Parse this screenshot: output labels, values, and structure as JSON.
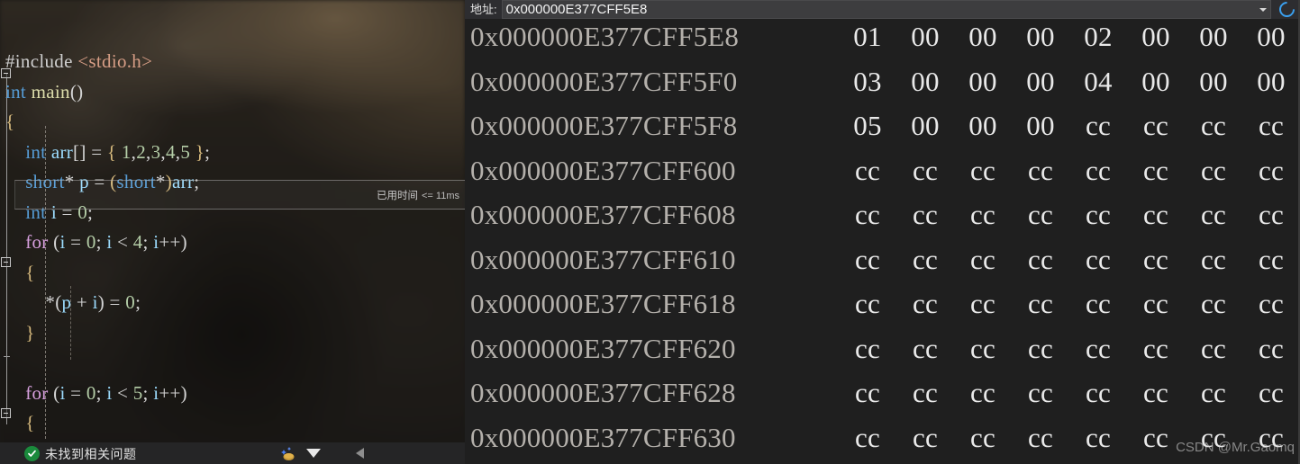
{
  "editor": {
    "code_lines": [
      {
        "indent": 0,
        "tokens": [
          {
            "t": "#include ",
            "c": "pre"
          },
          {
            "t": "<stdio.h>",
            "c": "inc"
          }
        ]
      },
      {
        "indent": 0,
        "tokens": [
          {
            "t": "int ",
            "c": "kw"
          },
          {
            "t": "main",
            "c": "fn"
          },
          {
            "t": "()",
            "c": "punct"
          }
        ]
      },
      {
        "indent": 0,
        "tokens": [
          {
            "t": "{",
            "c": "brace"
          }
        ]
      },
      {
        "indent": 1,
        "tokens": [
          {
            "t": "int ",
            "c": "kw"
          },
          {
            "t": "arr",
            "c": "var"
          },
          {
            "t": "[]",
            "c": "punct"
          },
          {
            "t": " = ",
            "c": "op"
          },
          {
            "t": "{ ",
            "c": "brace"
          },
          {
            "t": "1",
            "c": "num"
          },
          {
            "t": ",",
            "c": "punct"
          },
          {
            "t": "2",
            "c": "num"
          },
          {
            "t": ",",
            "c": "punct"
          },
          {
            "t": "3",
            "c": "num"
          },
          {
            "t": ",",
            "c": "punct"
          },
          {
            "t": "4",
            "c": "num"
          },
          {
            "t": ",",
            "c": "punct"
          },
          {
            "t": "5",
            "c": "num"
          },
          {
            "t": " }",
            "c": "brace"
          },
          {
            "t": ";",
            "c": "punct"
          }
        ]
      },
      {
        "indent": 1,
        "tokens": [
          {
            "t": "short",
            "c": "kw"
          },
          {
            "t": "* ",
            "c": "punct"
          },
          {
            "t": "p",
            "c": "var"
          },
          {
            "t": " = ",
            "c": "op"
          },
          {
            "t": "(",
            "c": "brace"
          },
          {
            "t": "short",
            "c": "kw"
          },
          {
            "t": "*",
            "c": "punct"
          },
          {
            "t": ")",
            "c": "brace"
          },
          {
            "t": "arr",
            "c": "var"
          },
          {
            "t": ";",
            "c": "punct"
          }
        ]
      },
      {
        "indent": 1,
        "tokens": [
          {
            "t": "int ",
            "c": "kw"
          },
          {
            "t": "i",
            "c": "var"
          },
          {
            "t": " = ",
            "c": "op"
          },
          {
            "t": "0",
            "c": "num"
          },
          {
            "t": ";",
            "c": "punct"
          }
        ]
      },
      {
        "indent": 1,
        "tokens": [
          {
            "t": "for",
            "c": "ctl"
          },
          {
            "t": " (",
            "c": "punct"
          },
          {
            "t": "i",
            "c": "var"
          },
          {
            "t": " = ",
            "c": "op"
          },
          {
            "t": "0",
            "c": "num"
          },
          {
            "t": "; ",
            "c": "punct"
          },
          {
            "t": "i",
            "c": "var"
          },
          {
            "t": " < ",
            "c": "op"
          },
          {
            "t": "4",
            "c": "num"
          },
          {
            "t": "; ",
            "c": "punct"
          },
          {
            "t": "i",
            "c": "var"
          },
          {
            "t": "++)",
            "c": "punct"
          }
        ]
      },
      {
        "indent": 1,
        "tokens": [
          {
            "t": "{",
            "c": "brace"
          }
        ]
      },
      {
        "indent": 2,
        "tokens": [
          {
            "t": "*(",
            "c": "punct"
          },
          {
            "t": "p",
            "c": "var"
          },
          {
            "t": " + ",
            "c": "op"
          },
          {
            "t": "i",
            "c": "var"
          },
          {
            "t": ") = ",
            "c": "punct"
          },
          {
            "t": "0",
            "c": "num"
          },
          {
            "t": ";",
            "c": "punct"
          }
        ]
      },
      {
        "indent": 1,
        "tokens": [
          {
            "t": "}",
            "c": "brace"
          }
        ]
      },
      {
        "indent": 0,
        "tokens": []
      },
      {
        "indent": 1,
        "tokens": [
          {
            "t": "for",
            "c": "ctl"
          },
          {
            "t": " (",
            "c": "punct"
          },
          {
            "t": "i",
            "c": "var"
          },
          {
            "t": " = ",
            "c": "op"
          },
          {
            "t": "0",
            "c": "num"
          },
          {
            "t": "; ",
            "c": "punct"
          },
          {
            "t": "i",
            "c": "var"
          },
          {
            "t": " < ",
            "c": "op"
          },
          {
            "t": "5",
            "c": "num"
          },
          {
            "t": "; ",
            "c": "punct"
          },
          {
            "t": "i",
            "c": "var"
          },
          {
            "t": "++)",
            "c": "punct"
          }
        ]
      },
      {
        "indent": 1,
        "tokens": [
          {
            "t": "{",
            "c": "brace"
          }
        ]
      }
    ],
    "elapsed_label": "已用时间",
    "elapsed_value": "<= 11ms",
    "status_text": "未找到相关问题",
    "status_icon": "check-circle-icon"
  },
  "memory": {
    "address_label": "地址:",
    "address_value": "0x000000E377CFF5E8",
    "address_placeholder": "0x000000E377CFF5E8",
    "dropdown_icon": "chevron-down-icon",
    "refresh_icon": "refresh-icon",
    "accent_color": "#3aa0ef",
    "rows": [
      {
        "address": "0x000000E377CFF5E8",
        "bytes": [
          "01",
          "00",
          "00",
          "00",
          "02",
          "00",
          "00",
          "00"
        ]
      },
      {
        "address": "0x000000E377CFF5F0",
        "bytes": [
          "03",
          "00",
          "00",
          "00",
          "04",
          "00",
          "00",
          "00"
        ]
      },
      {
        "address": "0x000000E377CFF5F8",
        "bytes": [
          "05",
          "00",
          "00",
          "00",
          "cc",
          "cc",
          "cc",
          "cc"
        ]
      },
      {
        "address": "0x000000E377CFF600",
        "bytes": [
          "cc",
          "cc",
          "cc",
          "cc",
          "cc",
          "cc",
          "cc",
          "cc"
        ]
      },
      {
        "address": "0x000000E377CFF608",
        "bytes": [
          "cc",
          "cc",
          "cc",
          "cc",
          "cc",
          "cc",
          "cc",
          "cc"
        ]
      },
      {
        "address": "0x000000E377CFF610",
        "bytes": [
          "cc",
          "cc",
          "cc",
          "cc",
          "cc",
          "cc",
          "cc",
          "cc"
        ]
      },
      {
        "address": "0x000000E377CFF618",
        "bytes": [
          "cc",
          "cc",
          "cc",
          "cc",
          "cc",
          "cc",
          "cc",
          "cc"
        ]
      },
      {
        "address": "0x000000E377CFF620",
        "bytes": [
          "cc",
          "cc",
          "cc",
          "cc",
          "cc",
          "cc",
          "cc",
          "cc"
        ]
      },
      {
        "address": "0x000000E377CFF628",
        "bytes": [
          "cc",
          "cc",
          "cc",
          "cc",
          "cc",
          "cc",
          "cc",
          "cc"
        ]
      },
      {
        "address": "0x000000E377CFF630",
        "bytes": [
          "cc",
          "cc",
          "cc",
          "cc",
          "cc",
          "cc",
          "cc",
          "cc"
        ]
      }
    ]
  },
  "watermark": "CSDN @Mr.Gaomq"
}
